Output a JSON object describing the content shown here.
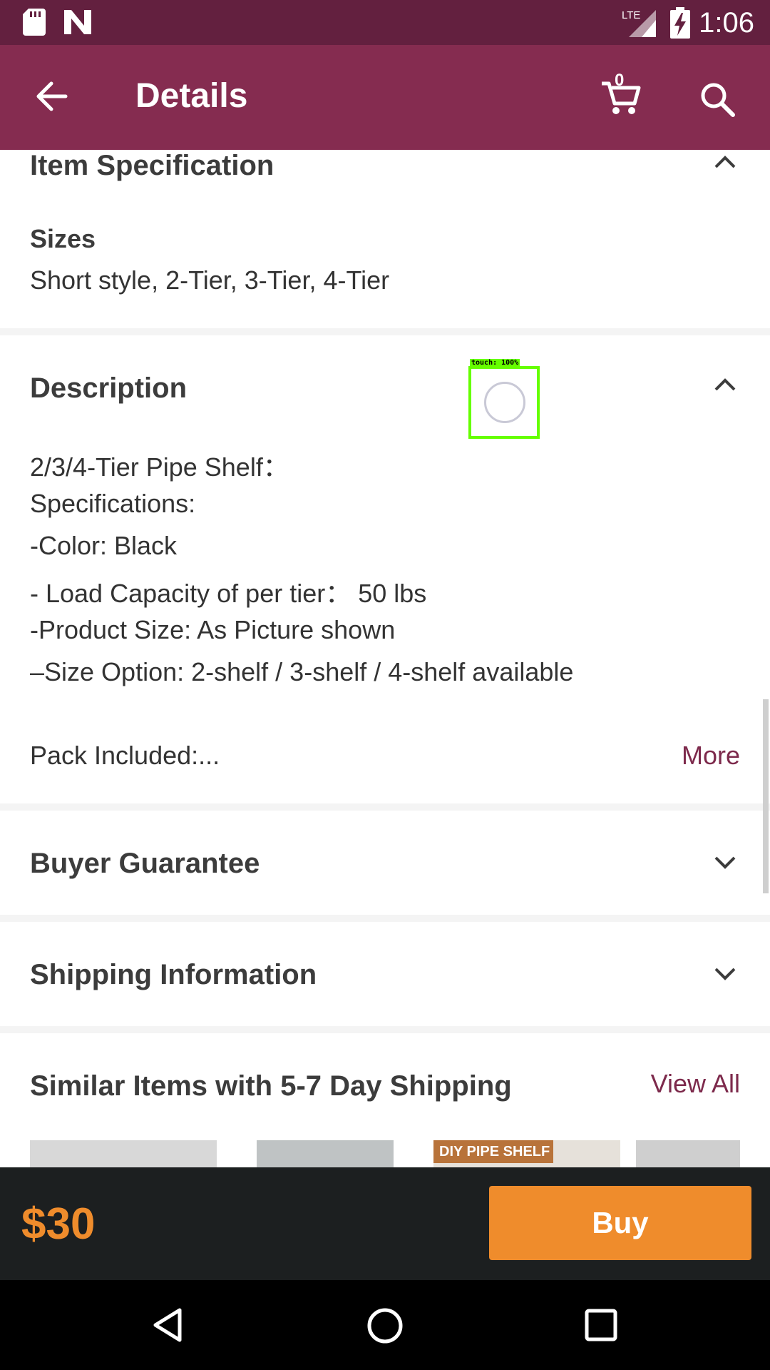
{
  "status_bar": {
    "time": "1:06",
    "network": "LTE",
    "icons": [
      "sd-card-icon",
      "n-logo-icon",
      "lte-signal-icon",
      "battery-charging-icon"
    ]
  },
  "app_bar": {
    "title": "Details",
    "cart_count": "0",
    "icons": [
      "back-arrow-icon",
      "shopping-cart-icon",
      "search-icon"
    ]
  },
  "item_specification": {
    "title": "Item Specification",
    "sizes_label": "Sizes",
    "sizes_value": "Short style, 2-Tier, 3-Tier, 4-Tier"
  },
  "description": {
    "title": "Description",
    "lines": [
      "2/3/4-Tier Pipe Shelf：",
      "Specifications:",
      "-Color: Black",
      "- Load Capacity of per tier：  50 lbs",
      "-Product Size: As Picture shown",
      "–Size Option: 2-shelf / 3-shelf / 4-shelf  available"
    ],
    "pack_included": "Pack Included:...",
    "more_label": "More"
  },
  "buyer_guarantee": {
    "title": "Buyer Guarantee"
  },
  "shipping_information": {
    "title": "Shipping Information"
  },
  "similar_items": {
    "title": "Similar Items with 5-7 Day Shipping",
    "view_all_label": "View All",
    "thumbnail_banner": "DIY PIPE SHELF"
  },
  "touch_overlay": {
    "label": "touch: 100%"
  },
  "bottom_bar": {
    "price": "$30",
    "buy_label": "Buy"
  },
  "colors": {
    "status_bar": "#63203f",
    "app_bar": "#852c50",
    "accent_orange": "#ef8c2c",
    "link": "#7d2a4c"
  }
}
